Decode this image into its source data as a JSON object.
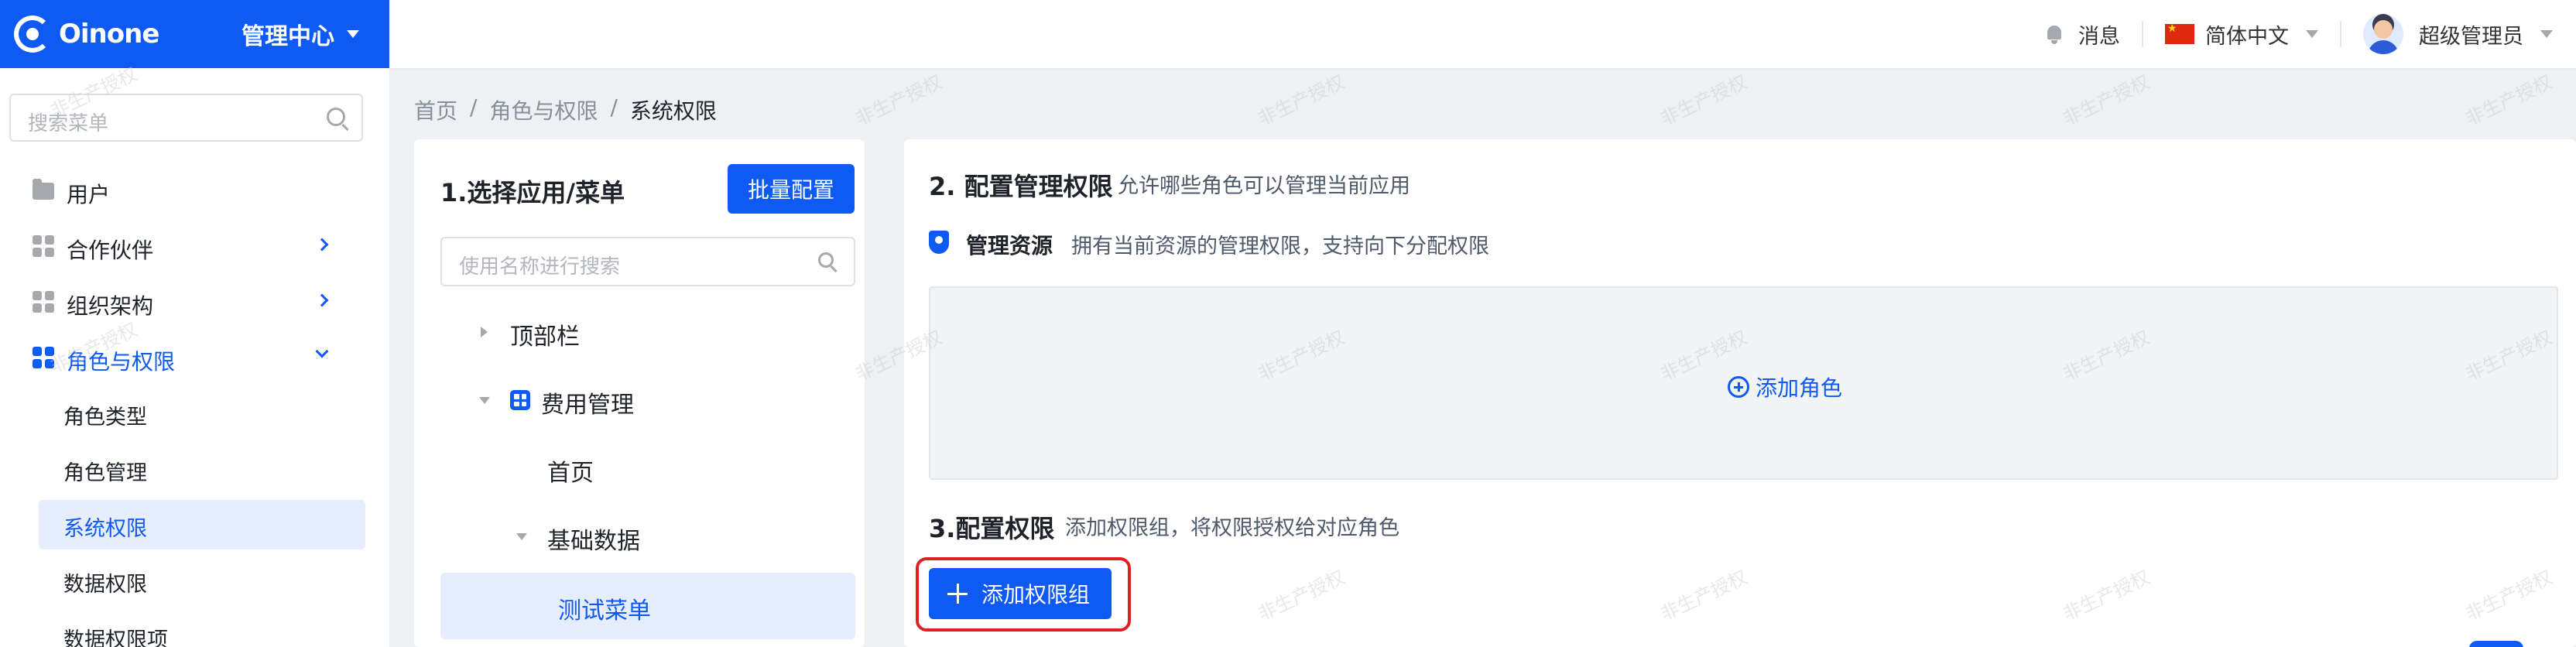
{
  "header": {
    "logo_text": "Oinone",
    "center_title": "管理中心",
    "messages_label": "消息",
    "language_label": "简体中文",
    "user_name": "超级管理员"
  },
  "sidebar": {
    "search_placeholder": "搜索菜单",
    "items": [
      {
        "label": "用户",
        "icon": "folder-icon",
        "expandable": false
      },
      {
        "label": "合作伙伴",
        "icon": "grid-icon",
        "expandable": true
      },
      {
        "label": "组织架构",
        "icon": "grid-icon",
        "expandable": true
      },
      {
        "label": "角色与权限",
        "icon": "grid-icon",
        "expandable": true,
        "expanded": true,
        "active": true
      }
    ],
    "sub_items": [
      {
        "label": "角色类型"
      },
      {
        "label": "角色管理"
      },
      {
        "label": "系统权限",
        "active": true
      },
      {
        "label": "数据权限"
      },
      {
        "label": "数据权限项"
      }
    ]
  },
  "breadcrumb": [
    "首页",
    "角色与权限",
    "系统权限"
  ],
  "app_panel": {
    "title": "1.选择应用/菜单",
    "batch_button": "批量配置",
    "search_placeholder": "使用名称进行搜索",
    "tree": [
      {
        "label": "顶部栏",
        "state": "collapsed"
      },
      {
        "label": "费用管理",
        "state": "expanded",
        "has_icon": true
      },
      {
        "label": "首页",
        "state": "leaf"
      },
      {
        "label": "基础数据",
        "state": "expanded"
      },
      {
        "label": "测试菜单",
        "state": "leaf",
        "selected": true
      }
    ]
  },
  "permission_panel": {
    "section2_title": "2. 配置管理权限",
    "section2_desc": "允许哪些角色可以管理当前应用",
    "resource_label": "管理资源",
    "resource_desc": "拥有当前资源的管理权限，支持向下分配权限",
    "add_role_label": "添加角色",
    "section3_title": "3.配置权限",
    "section3_desc": "添加权限组，将权限授权给对应角色",
    "add_group_button": "添加权限组"
  },
  "watermark_text": "非生产授权",
  "colors": {
    "primary": "#0f5af2",
    "highlight": "#e02020",
    "active_bg": "#e6edfd"
  }
}
